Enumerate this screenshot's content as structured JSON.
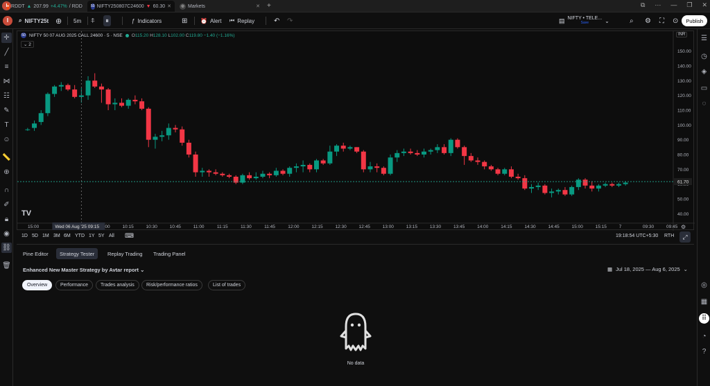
{
  "browser_tabs": [
    {
      "name": "RDDT",
      "price": "207.99",
      "change": "+4.47%",
      "rest": "/ RDD",
      "direction": "up"
    },
    {
      "name": "NIFTY250807C24600",
      "price": "60.30",
      "direction": "down"
    },
    {
      "name": "Markets"
    }
  ],
  "toolbar": {
    "symbol": "NIFTY25t",
    "interval": "5m",
    "indicators": "Indicators",
    "alert": "Alert",
    "replay": "Replay",
    "layout_name": "NIFTY • TELE...",
    "layout_status": "Save",
    "publish": "Publish"
  },
  "chart": {
    "legend_title": "NIFTY 50 07 AUG 2025 CALL 24600 · 5 · NSE",
    "open": "115.20",
    "high": "128.10",
    "low": "102.00",
    "close": "119.80",
    "change": "−1.40 (−1.16%)",
    "collapse_count": "2",
    "currency": "INR",
    "last_price": "61.70",
    "crosshair_time": "Wed 06 Aug '25  09:15",
    "last_price_color": "#22ab94",
    "up_color": "#089981",
    "down_color": "#f23645"
  },
  "chart_data": {
    "type": "candlestick",
    "y_ticks": [
      "150.00",
      "140.00",
      "130.00",
      "120.00",
      "110.00",
      "100.00",
      "90.00",
      "80.00",
      "70.00",
      "60.00",
      "50.00",
      "40.00"
    ],
    "ylim": [
      35,
      155
    ],
    "x_ticks": [
      "15:00",
      "",
      "09:45",
      "10:00",
      "10:15",
      "10:30",
      "10:45",
      "11:00",
      "11:15",
      "11:30",
      "11:45",
      "12:00",
      "12:15",
      "12:30",
      "12:45",
      "13:00",
      "13:15",
      "13:30",
      "13:45",
      "14:00",
      "14:15",
      "14:30",
      "14:45",
      "15:00",
      "15:15",
      "7",
      "09:30",
      "09:45"
    ],
    "candles": [
      [
        97,
        98,
        96,
        97
      ],
      [
        98,
        103,
        96,
        101
      ],
      [
        102,
        110,
        100,
        108
      ],
      [
        108,
        122,
        106,
        121
      ],
      [
        121,
        127,
        119,
        126
      ],
      [
        126,
        129,
        123,
        127
      ],
      [
        127,
        128,
        123,
        124
      ],
      [
        124,
        127,
        118,
        119
      ],
      [
        119,
        125,
        115,
        120
      ],
      [
        120,
        133,
        117,
        130
      ],
      [
        130,
        135,
        125,
        126
      ],
      [
        126,
        128,
        115,
        124
      ],
      [
        124,
        125,
        110,
        114
      ],
      [
        114,
        118,
        110,
        115
      ],
      [
        115,
        118,
        112,
        113
      ],
      [
        113,
        118,
        111,
        117
      ],
      [
        117,
        120,
        114,
        116
      ],
      [
        116,
        118,
        110,
        111
      ],
      [
        111,
        112,
        85,
        90
      ],
      [
        90,
        94,
        84,
        92
      ],
      [
        92,
        96,
        89,
        93
      ],
      [
        93,
        101,
        90,
        98
      ],
      [
        98,
        100,
        95,
        97
      ],
      [
        97,
        99,
        86,
        88
      ],
      [
        88,
        90,
        78,
        80
      ],
      [
        80,
        82,
        65,
        68
      ],
      [
        68,
        71,
        65,
        69
      ],
      [
        69,
        70,
        65,
        68
      ],
      [
        68,
        70,
        66,
        67
      ],
      [
        67,
        68,
        65,
        66
      ],
      [
        66,
        67,
        64,
        65
      ],
      [
        65,
        66,
        60,
        61
      ],
      [
        61,
        67,
        60,
        66
      ],
      [
        66,
        68,
        63,
        64
      ],
      [
        64,
        68,
        63,
        65
      ],
      [
        65,
        69,
        64,
        67
      ],
      [
        67,
        68,
        64,
        66
      ],
      [
        66,
        71,
        65,
        69
      ],
      [
        69,
        70,
        66,
        67
      ],
      [
        67,
        72,
        65,
        71
      ],
      [
        71,
        74,
        68,
        72
      ],
      [
        72,
        76,
        68,
        73
      ],
      [
        73,
        74,
        68,
        70
      ],
      [
        70,
        77,
        68,
        76
      ],
      [
        76,
        77,
        73,
        74
      ],
      [
        74,
        86,
        73,
        82
      ],
      [
        82,
        87,
        79,
        86
      ],
      [
        86,
        88,
        82,
        84
      ],
      [
        84,
        86,
        83,
        85
      ],
      [
        85,
        85,
        81,
        82
      ],
      [
        82,
        83,
        68,
        70
      ],
      [
        70,
        75,
        68,
        72
      ],
      [
        72,
        74,
        68,
        71
      ],
      [
        71,
        72,
        66,
        67
      ],
      [
        67,
        80,
        66,
        78
      ],
      [
        78,
        83,
        75,
        81
      ],
      [
        81,
        84,
        79,
        82
      ],
      [
        82,
        84,
        80,
        81
      ],
      [
        81,
        83,
        79,
        80
      ],
      [
        80,
        84,
        78,
        82
      ],
      [
        82,
        84,
        80,
        83
      ],
      [
        83,
        87,
        81,
        85
      ],
      [
        85,
        87,
        80,
        81
      ],
      [
        81,
        91,
        79,
        90
      ],
      [
        90,
        91,
        84,
        85
      ],
      [
        85,
        86,
        73,
        79
      ],
      [
        79,
        81,
        75,
        76
      ],
      [
        76,
        78,
        73,
        75
      ],
      [
        75,
        76,
        70,
        72
      ],
      [
        72,
        73,
        69,
        70
      ],
      [
        70,
        71,
        66,
        67
      ],
      [
        67,
        71,
        66,
        70
      ],
      [
        70,
        72,
        64,
        65
      ],
      [
        65,
        67,
        63,
        64
      ],
      [
        64,
        66,
        56,
        57
      ],
      [
        57,
        60,
        54,
        58
      ],
      [
        58,
        61,
        56,
        59
      ],
      [
        59,
        60,
        53,
        54
      ],
      [
        54,
        57,
        51,
        55
      ],
      [
        55,
        57,
        53,
        56
      ],
      [
        56,
        58,
        52,
        53
      ],
      [
        53,
        59,
        52,
        58
      ],
      [
        58,
        64,
        56,
        63
      ],
      [
        63,
        64,
        57,
        59
      ],
      [
        59,
        62,
        55,
        57
      ],
      [
        57,
        60,
        55,
        59
      ],
      [
        59,
        61,
        58,
        60
      ],
      [
        60,
        61,
        58,
        59
      ],
      [
        59,
        61,
        58,
        60
      ],
      [
        60,
        62,
        59,
        61
      ]
    ],
    "crosshair_x_label": "Wed 06 Aug '25  09:15"
  },
  "timeframes": [
    "1D",
    "5D",
    "1M",
    "3M",
    "6M",
    "YTD",
    "1Y",
    "5Y",
    "All"
  ],
  "status_bar": {
    "time": "19:18:54 UTC+5:30",
    "session": "RTH"
  },
  "panel": {
    "tabs": [
      "Pine Editor",
      "Strategy Tester",
      "Replay Trading",
      "Trading Panel"
    ],
    "active_tab": 1,
    "strategy_name": "Enhanced New Master Strategy by Avtar report",
    "date_range": "Jul 18, 2025 — Aug 6, 2025",
    "subtabs": [
      "Overview",
      "Performance",
      "Trades analysis",
      "Risk/performance ratios",
      "List of trades"
    ],
    "active_subtab": 0,
    "empty_text": "No data"
  }
}
